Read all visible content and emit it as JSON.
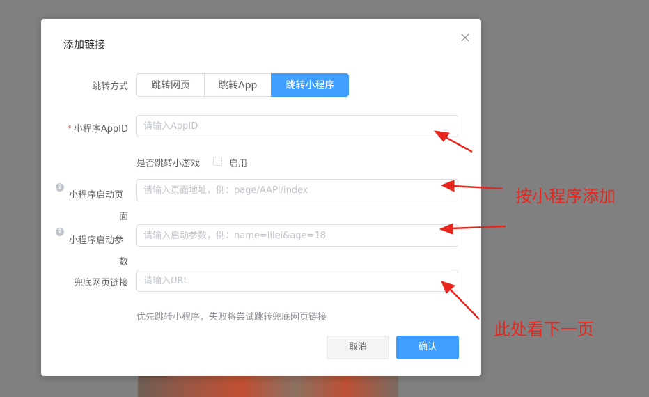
{
  "dialog": {
    "title": "添加链接",
    "close_icon": "close-icon"
  },
  "jump_mode": {
    "label": "跳转方式",
    "options": [
      "跳转网页",
      "跳转App",
      "跳转小程序"
    ],
    "selected": "跳转小程序"
  },
  "appid": {
    "required_mark": "*",
    "label": "小程序AppID",
    "placeholder": "请输入AppID",
    "value": ""
  },
  "mini_game": {
    "label": "是否跳转小游戏",
    "checkbox_label": "启用",
    "checked": false
  },
  "start_page": {
    "help_icon": "question-circle-icon",
    "label_line1": "小程序启动页",
    "label_line2": "面",
    "placeholder": "请输入页面地址，例：page/AAPI/index"
  },
  "start_params": {
    "help_icon": "question-circle-icon",
    "label_line1": "小程序启动参",
    "label_line2": "数",
    "placeholder": "请输入启动参数，例：name=lilei&age=18"
  },
  "fallback_url": {
    "label": "兜底网页链接",
    "placeholder": "请输入URL"
  },
  "hint": "优先跳转小程序，失败将尝试跳转兜底网页链接",
  "buttons": {
    "cancel": "取消",
    "confirm": "确认"
  },
  "annotations": {
    "add_by_miniprogram": "按小程序添加",
    "see_next_page": "此处看下一页"
  },
  "colors": {
    "primary": "#409eff",
    "required": "#f56c6c",
    "annotation": "#e8261d"
  }
}
